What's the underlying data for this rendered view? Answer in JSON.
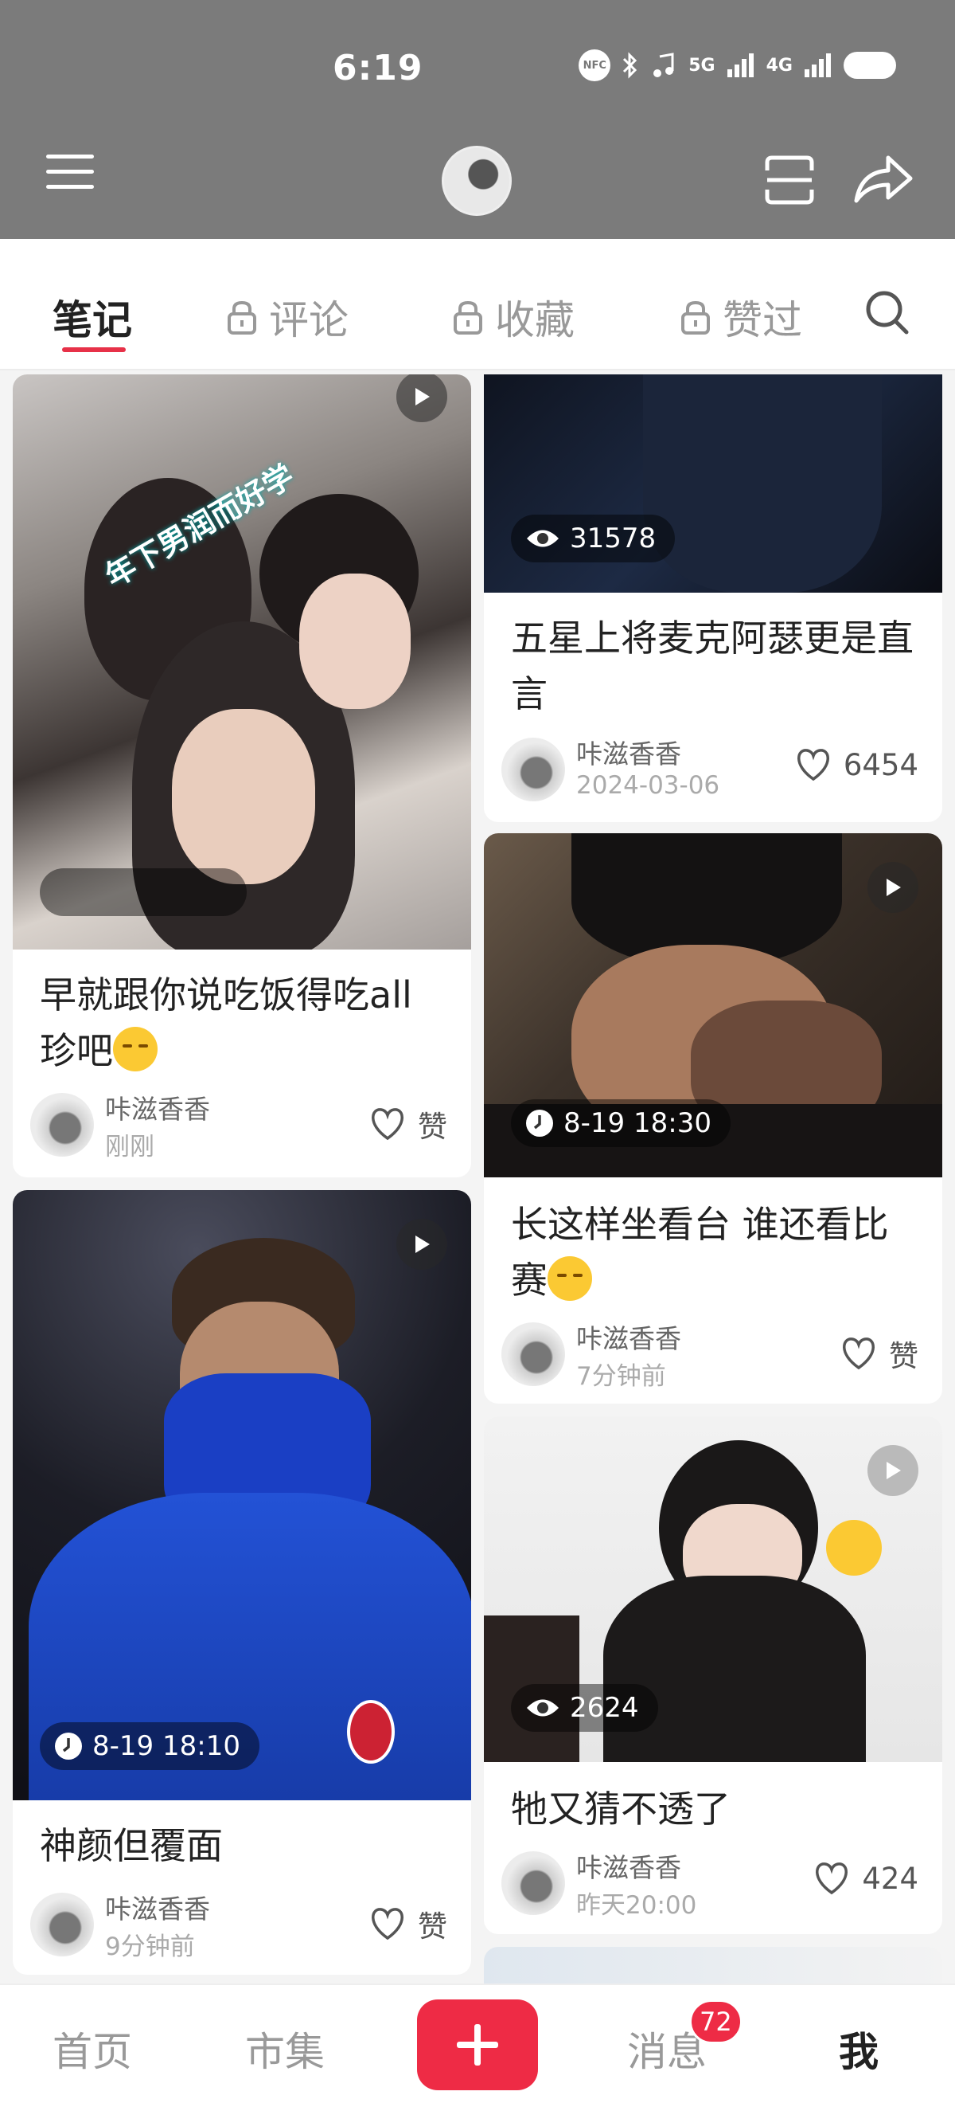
{
  "status_bar": {
    "time": "6:19",
    "nfc": "NFC",
    "signal1": "5G",
    "signal2": "4G"
  },
  "tabs": [
    {
      "label": "笔记",
      "active": true,
      "locked": false
    },
    {
      "label": "评论",
      "active": false,
      "locked": true
    },
    {
      "label": "收藏",
      "active": false,
      "locked": true
    },
    {
      "label": "赞过",
      "active": false,
      "locked": true
    }
  ],
  "posts": {
    "p1": {
      "title": "早就跟你说吃饭得吃all珍吧",
      "author": "咔滋香香",
      "date": "刚刚",
      "likes": "赞",
      "is_video": true,
      "image_text": "年下男润而好学"
    },
    "p2": {
      "title": "神颜但覆面",
      "author": "咔滋香香",
      "date": "9分钟前",
      "likes": "赞",
      "is_video": true,
      "overlay": "8-19 18:10"
    },
    "p3": {
      "title": "五星上将麦克阿瑟更是直言",
      "author": "咔滋香香",
      "date": "2024-03-06",
      "likes": "6454",
      "views": "31578"
    },
    "p4": {
      "title": "长这样坐看台 谁还看比赛",
      "author": "咔滋香香",
      "date": "7分钟前",
      "likes": "赞",
      "is_video": true,
      "overlay": "8-19 18:30"
    },
    "p5": {
      "title": "牠又猜不透了",
      "author": "咔滋香香",
      "date": "昨天20:00",
      "likes": "424",
      "is_video": true,
      "views": "2624"
    }
  },
  "bottom_nav": {
    "home": "首页",
    "market": "市集",
    "messages": "消息",
    "me": "我",
    "messages_badge": "72"
  },
  "colors": {
    "accent": "#ee2b45",
    "topbar": "#7b7b7b"
  }
}
